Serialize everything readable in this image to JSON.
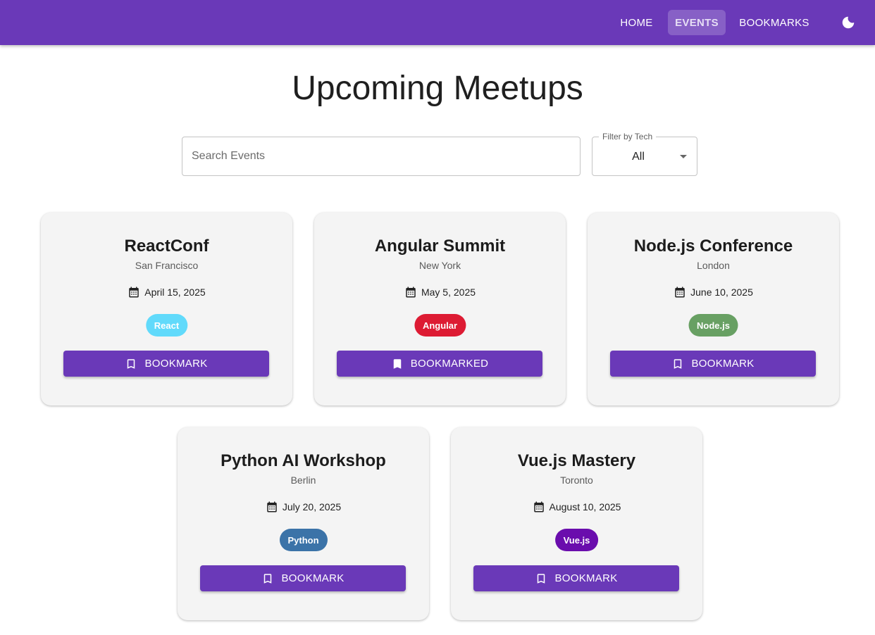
{
  "nav": {
    "items": [
      {
        "label": "HOME"
      },
      {
        "label": "EVENTS"
      },
      {
        "label": "BOOKMARKS"
      }
    ],
    "active": "EVENTS",
    "theme_icon": "moon-icon"
  },
  "page": {
    "title": "Upcoming Meetups"
  },
  "search": {
    "placeholder": "Search Events",
    "value": ""
  },
  "filter": {
    "label": "Filter by Tech",
    "value": "All"
  },
  "colors": {
    "primary": "#6a39b8",
    "card_bg": "#f4f4f4"
  },
  "events": [
    {
      "title": "ReactConf",
      "location": "San Francisco",
      "date": "April 15, 2025",
      "tag": "React",
      "tag_color": "#61dafb",
      "button": "BOOKMARK",
      "bookmarked": false
    },
    {
      "title": "Angular Summit",
      "location": "New York",
      "date": "May 5, 2025",
      "tag": "Angular",
      "tag_color": "#dd1b33",
      "button": "BOOKMARKED",
      "bookmarked": true
    },
    {
      "title": "Node.js Conference",
      "location": "London",
      "date": "June 10, 2025",
      "tag": "Node.js",
      "tag_color": "#68a063",
      "button": "BOOKMARK",
      "bookmarked": false
    },
    {
      "title": "Python AI Workshop",
      "location": "Berlin",
      "date": "July 20, 2025",
      "tag": "Python",
      "tag_color": "#3b73a8",
      "button": "BOOKMARK",
      "bookmarked": false
    },
    {
      "title": "Vue.js Mastery",
      "location": "Toronto",
      "date": "August 10, 2025",
      "tag": "Vue.js",
      "tag_color": "#6a0dad",
      "button": "BOOKMARK",
      "bookmarked": false
    }
  ]
}
